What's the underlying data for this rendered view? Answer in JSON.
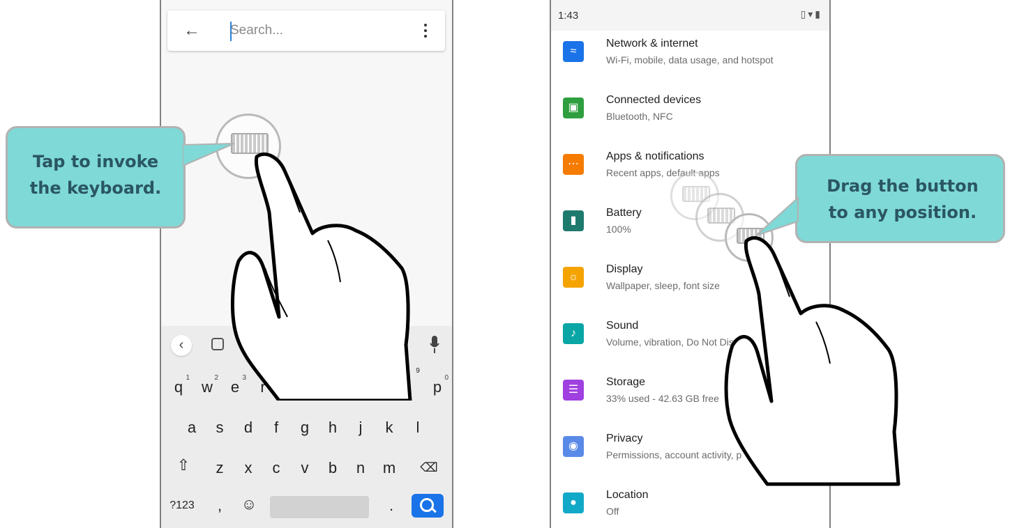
{
  "left_phone": {
    "search": {
      "placeholder": "Search..."
    },
    "keyboard": {
      "row1": [
        {
          "key": "q",
          "num": "1"
        },
        {
          "key": "w",
          "num": "2"
        },
        {
          "key": "e",
          "num": "3"
        },
        {
          "key": "r",
          "num": ""
        },
        {
          "key": "p",
          "num": "0"
        }
      ],
      "row1_hint_9": "9",
      "row2": [
        "a",
        "s",
        "d",
        "f",
        "g",
        "h",
        "j",
        "k",
        "l"
      ],
      "row3": [
        "z",
        "x",
        "c",
        "v",
        "b",
        "n",
        "m"
      ],
      "symbols_key": "?123",
      "comma_key": ",",
      "period_key": "."
    },
    "callout": {
      "line1": "Tap to invoke",
      "line2": "the keyboard."
    }
  },
  "right_phone": {
    "status": {
      "time": "1:43"
    },
    "settings": [
      {
        "title": "Network & internet",
        "sub": "Wi-Fi, mobile, data usage, and hotspot",
        "color": "#1a73e8",
        "icon": "wifi-icon"
      },
      {
        "title": "Connected devices",
        "sub": "Bluetooth, NFC",
        "color": "#2e9e3e",
        "icon": "devices-icon"
      },
      {
        "title": "Apps & notifications",
        "sub": "Recent apps, default apps",
        "color": "#f57c00",
        "icon": "apps-icon"
      },
      {
        "title": "Battery",
        "sub": "100%",
        "color": "#1f7a6e",
        "icon": "battery-icon"
      },
      {
        "title": "Display",
        "sub": "Wallpaper, sleep, font size",
        "color": "#f5a300",
        "icon": "display-icon"
      },
      {
        "title": "Sound",
        "sub": "Volume, vibration, Do Not Disturb",
        "color": "#0aa5a5",
        "icon": "sound-icon"
      },
      {
        "title": "Storage",
        "sub": "33% used - 42.63 GB free",
        "color": "#a040e0",
        "icon": "storage-icon"
      },
      {
        "title": "Privacy",
        "sub": "Permissions, account activity, p",
        "color": "#5a8ae8",
        "icon": "privacy-icon"
      },
      {
        "title": "Location",
        "sub": "Off",
        "color": "#12a8c8",
        "icon": "location-icon"
      }
    ],
    "callout": {
      "line1": "Drag the button",
      "line2": "to any position."
    }
  }
}
